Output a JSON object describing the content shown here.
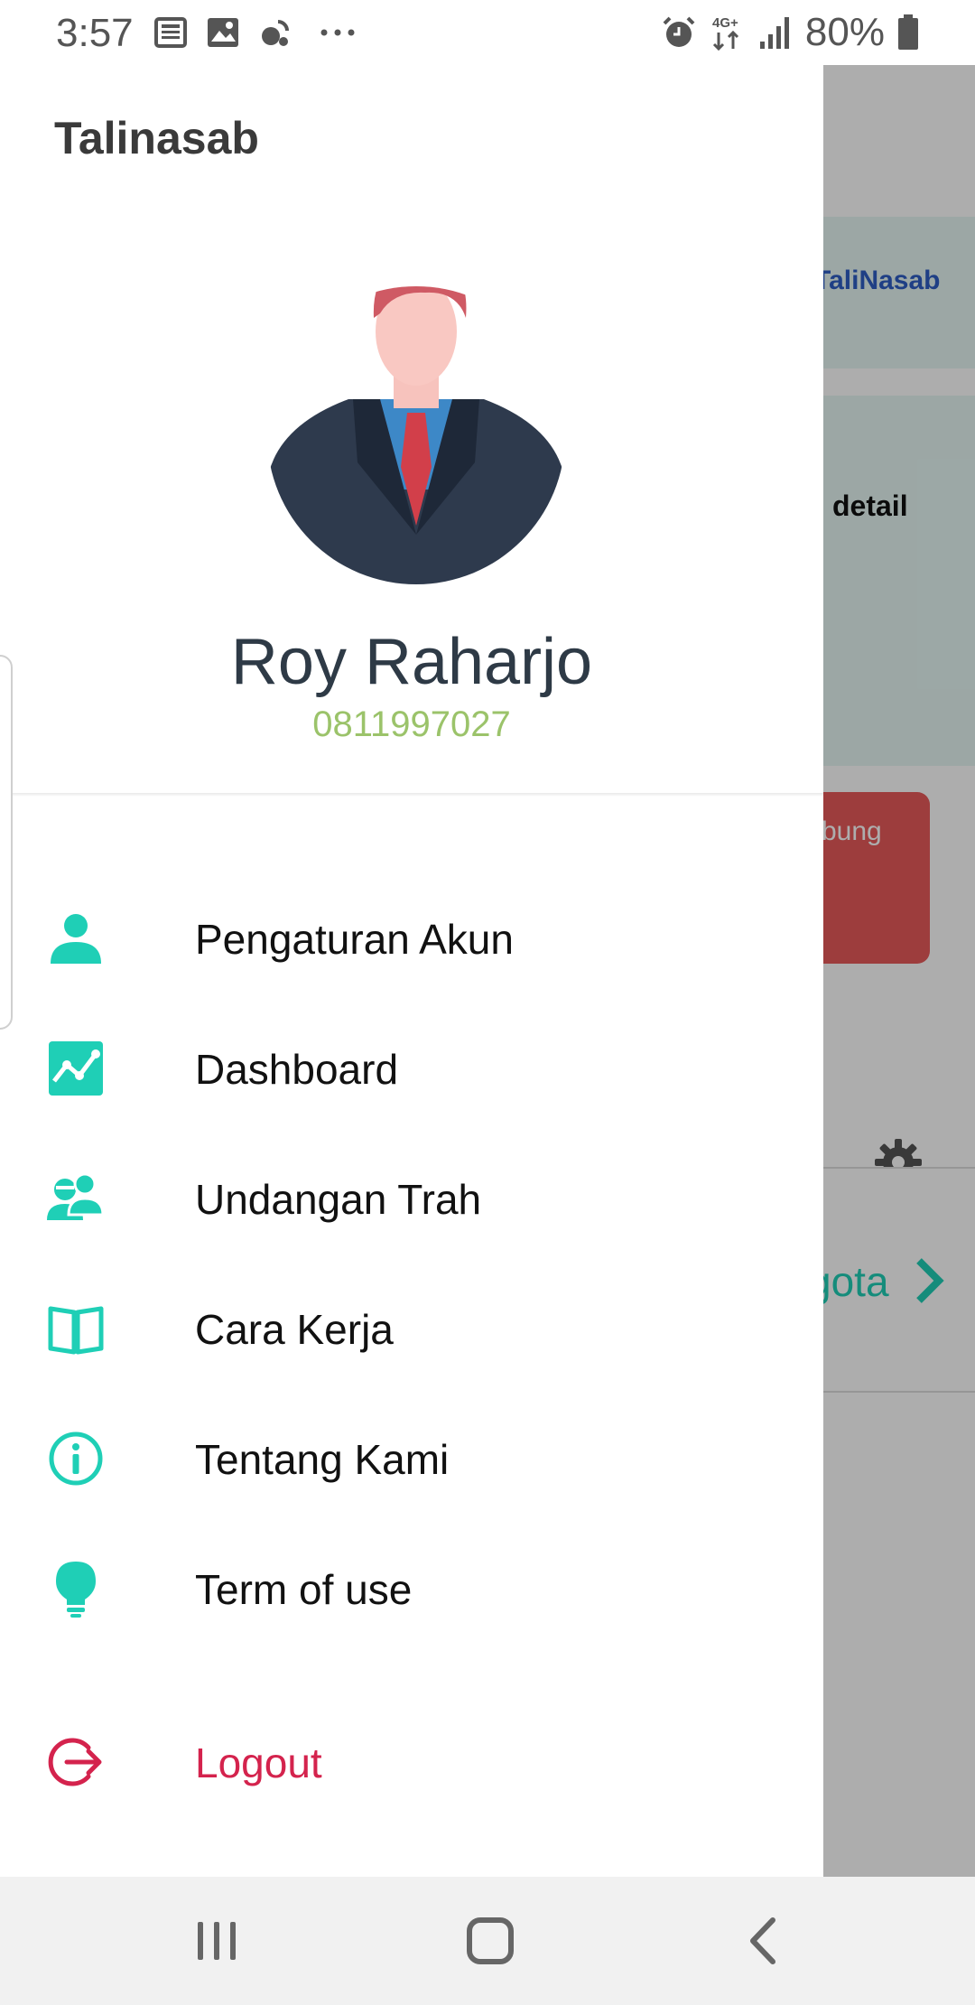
{
  "status_bar": {
    "time": "3:57",
    "battery": "80%",
    "network": "4G+",
    "icons": [
      "news-icon",
      "image-icon",
      "satellite-icon",
      "more-icon",
      "alarm-icon",
      "network-icon",
      "signal-icon",
      "battery-icon"
    ]
  },
  "background": {
    "brand": "TaliNasab",
    "detail_text": "detail",
    "red_card_text": "bung",
    "row_text": "gota"
  },
  "drawer": {
    "title": "Talinasab",
    "user_name": "Roy Raharjo",
    "user_phone": "0811997027",
    "menu": [
      {
        "label": "Pengaturan Akun",
        "icon": "person-icon"
      },
      {
        "label": "Dashboard",
        "icon": "chart-icon"
      },
      {
        "label": "Undangan Trah",
        "icon": "people-icon"
      },
      {
        "label": "Cara Kerja",
        "icon": "book-icon"
      },
      {
        "label": "Tentang Kami",
        "icon": "info-icon"
      },
      {
        "label": "Term of use",
        "icon": "lightbulb-icon"
      }
    ],
    "logout_label": "Logout"
  },
  "colors": {
    "accent": "#1fcfb6",
    "logout": "#d4234d",
    "phone": "#9bc36a",
    "brand_blue": "#2f5ec4"
  },
  "nav_bar": {
    "icons": [
      "recents-icon",
      "home-icon",
      "back-icon"
    ]
  }
}
